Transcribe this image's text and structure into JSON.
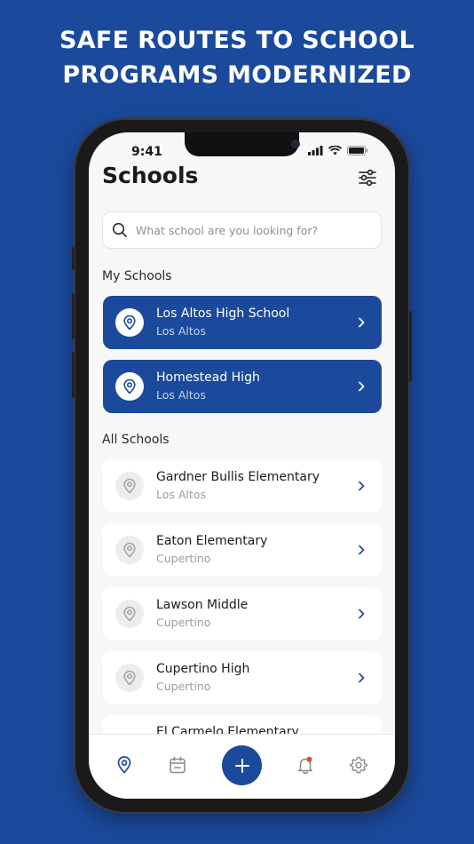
{
  "headline": {
    "line1": "SAFE ROUTES TO SCHOOL",
    "line2": "PROGRAMS MODERNIZED"
  },
  "status_bar": {
    "time": "9:41"
  },
  "header": {
    "title": "Schools",
    "filter_icon": "sliders-icon"
  },
  "search": {
    "placeholder": "What school are you looking for?",
    "value": ""
  },
  "my_schools": {
    "label": "My Schools",
    "items": [
      {
        "name": "Los Altos High School",
        "city": "Los Altos"
      },
      {
        "name": "Homestead High",
        "city": "Los Altos"
      }
    ]
  },
  "all_schools": {
    "label": "All Schools",
    "items": [
      {
        "name": "Gardner Bullis Elementary",
        "city": "Los Altos"
      },
      {
        "name": "Eaton Elementary",
        "city": "Cupertino"
      },
      {
        "name": "Lawson Middle",
        "city": "Cupertino"
      },
      {
        "name": "Cupertino High",
        "city": "Cupertino"
      },
      {
        "name": "El Carmelo Elementary",
        "city": ""
      }
    ]
  },
  "tab_bar": {
    "tabs": [
      "map-pin-icon",
      "calendar-icon",
      "plus-icon",
      "bell-icon",
      "gear-icon"
    ],
    "active": "map-pin-icon"
  },
  "colors": {
    "brand": "#1b4a9c",
    "background": "#f7f7f8",
    "notification": "#e8452c"
  }
}
